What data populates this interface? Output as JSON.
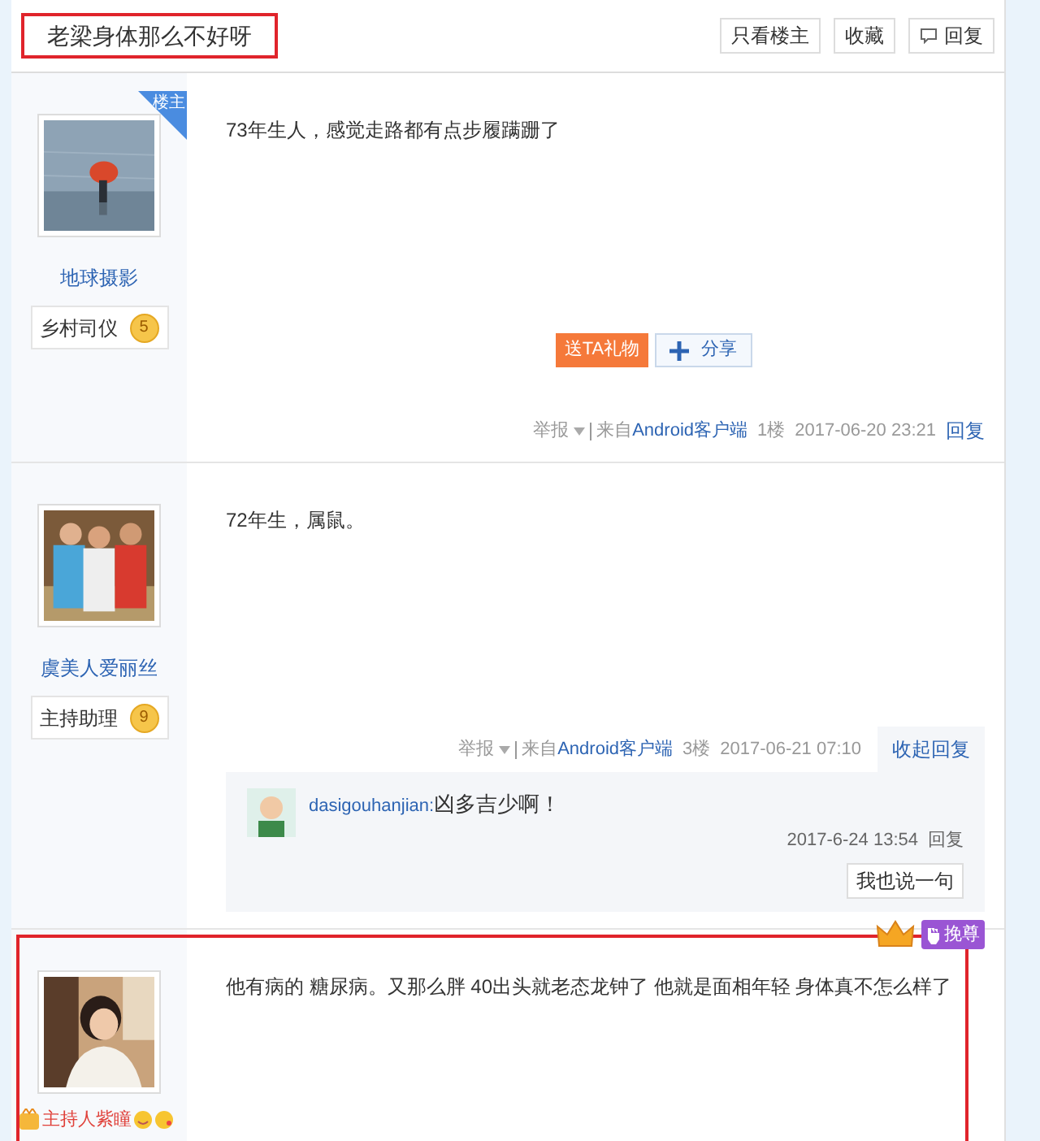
{
  "thread": {
    "title": "老梁身体那么不好呀",
    "highlighted": true,
    "buttons": [
      {
        "label": "只看楼主",
        "kind": "plain"
      },
      {
        "label": "收藏",
        "kind": "plain"
      },
      {
        "label": "回复",
        "kind": "reply"
      }
    ]
  },
  "posts": [
    {
      "author": {
        "name": "地球摄影",
        "vip": false,
        "ribbon": "楼主",
        "rank": "乡村司仪",
        "level": "5"
      },
      "text": "73年生人，感觉走路都有点步履蹒跚了",
      "highlighted": false,
      "actions": {
        "gift": "送TA礼物",
        "share": "分享"
      },
      "footer": {
        "report": "举报",
        "source_prefix": "来自",
        "source": "Android客户端",
        "floor": "1楼",
        "time": "2017-06-20 23:21",
        "reply": "回复",
        "expanded": false
      }
    },
    {
      "author": {
        "name": "虞美人爱丽丝",
        "vip": false,
        "rank": "主持助理",
        "level": "9"
      },
      "text": "72年生，属鼠。",
      "highlighted": false,
      "footer": {
        "report": "举报",
        "source_prefix": "来自",
        "source": "Android客户端",
        "floor": "3楼",
        "time": "2017-06-21 07:10",
        "reply": "收起回复",
        "expanded": true
      },
      "replies": [
        {
          "user": "dasigouhanjian:",
          "text": "凶多吉少啊！",
          "time": "2017-6-24 13:54",
          "reply": "回复"
        }
      ],
      "say": "我也说一句"
    },
    {
      "author": {
        "name": "主持人紫瞳",
        "vip": true
      },
      "text": "他有病的 糖尿病。又那么胖 40出头就老态龙钟了 他就是面相年轻 身体真不怎么样了",
      "highlighted": true,
      "badge": "挽尊"
    }
  ]
}
